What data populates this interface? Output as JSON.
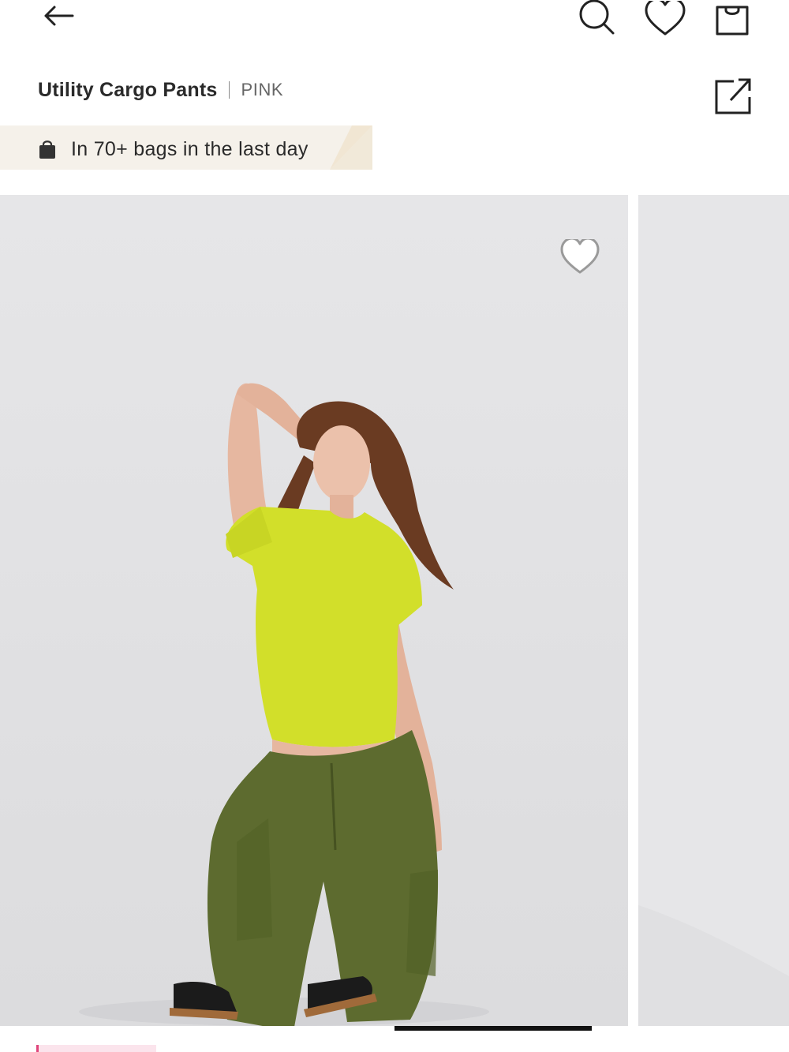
{
  "header": {
    "back_icon": "arrow-left-icon",
    "search_icon": "search-icon",
    "wishlist_icon": "heart-icon",
    "bag_icon": "shopping-bag-icon"
  },
  "product": {
    "title": "Utility Cargo Pants",
    "brand": "PINK",
    "share_icon": "share-icon"
  },
  "social_proof": {
    "icon": "shopping-bag-icon",
    "text": "In 70+ bags in the last day",
    "background": "#f5f1ea"
  },
  "gallery": {
    "images": [
      {
        "subject": "model-yellow-top-olive-cargo-pants"
      },
      {
        "subject": "model-partial-next-image"
      }
    ],
    "favorite_icon": "heart-outline-icon",
    "active_index": 1,
    "total_indicators": 2
  },
  "colors": {
    "accent_pink": "#e0457b",
    "banner_bg": "#f5f1ea",
    "image_bg": "#e6e6e8",
    "top_color": "#d2df2a",
    "pants_color": "#5d6b2f"
  }
}
